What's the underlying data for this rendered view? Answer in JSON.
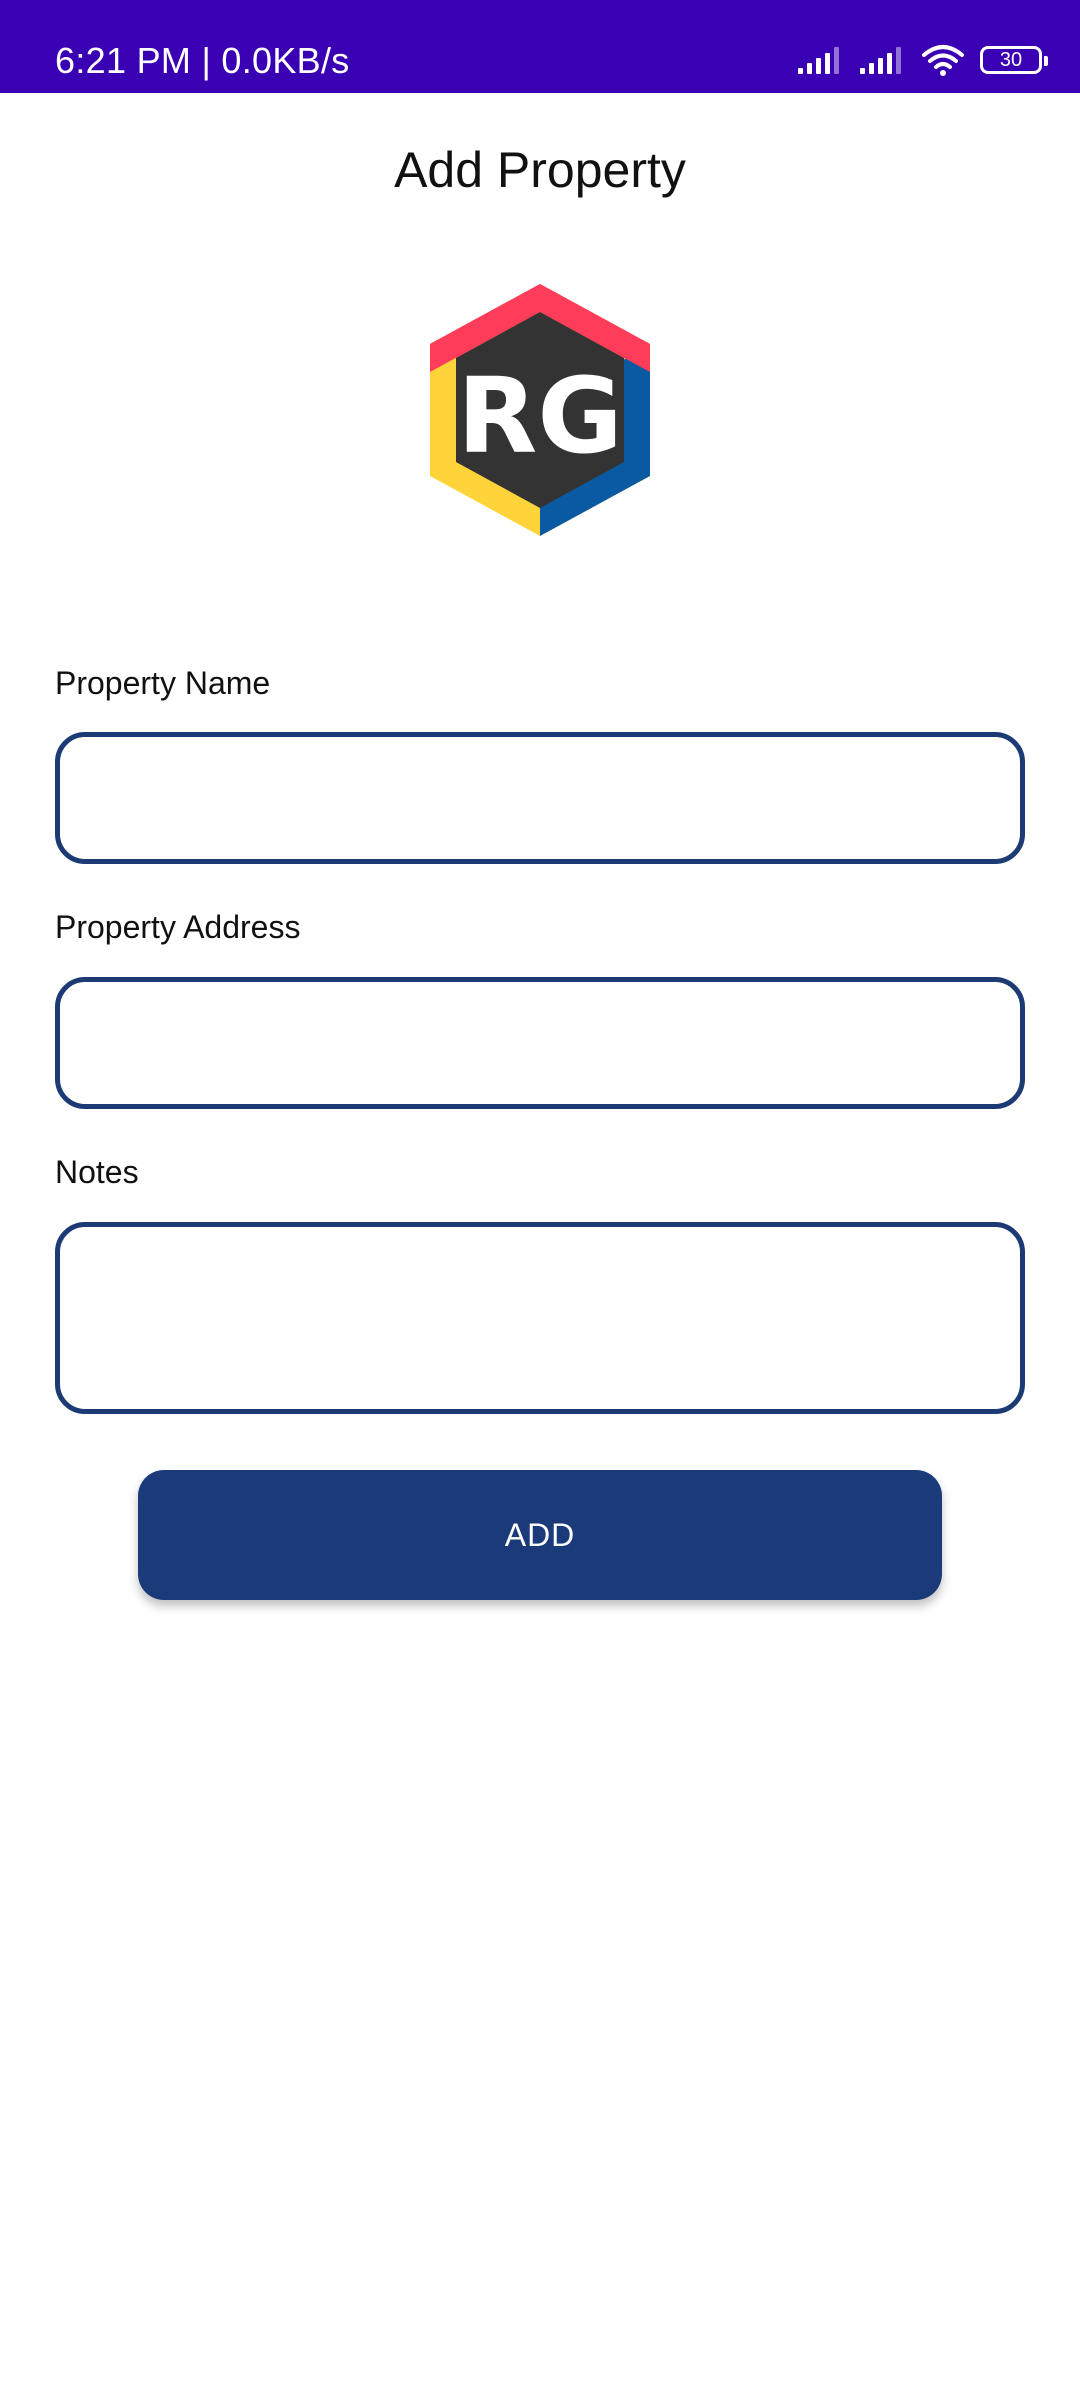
{
  "status_bar": {
    "time_network": "6:21 PM | 0.0KB/s",
    "battery_level": "30",
    "icons": [
      "signal-icon",
      "signal-icon",
      "wifi-icon",
      "battery-icon"
    ],
    "background_color": "#3a00b3"
  },
  "header": {
    "title": "Add Property"
  },
  "logo": {
    "text": "RG",
    "colors": [
      "#ff3d5a",
      "#0a5aa3",
      "#ffd43a",
      "#333333"
    ]
  },
  "form": {
    "property_name_label": "Property Name",
    "property_name_value": "",
    "property_address_label": "Property Address",
    "property_address_value": "",
    "notes_label": "Notes",
    "notes_value": "",
    "border_color": "#1c3a74"
  },
  "actions": {
    "add_label": "ADD",
    "button_color": "#1a3a7a"
  }
}
